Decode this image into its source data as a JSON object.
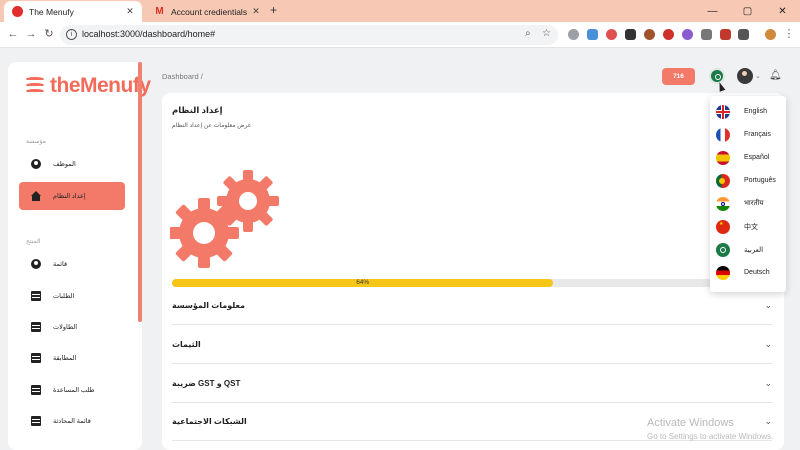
{
  "browser": {
    "tabs": [
      {
        "title": "The Menufy",
        "close": "✕"
      },
      {
        "title": "Account credientials - salimmal",
        "close": "✕"
      }
    ],
    "new_tab": "+",
    "url": "localhost:3000/dashboard/home#"
  },
  "app": {
    "logo_text": "theMenufy",
    "sidebar": {
      "section1": "مؤسسة",
      "items1": [
        {
          "label": "الموظف",
          "icon": "person-icon"
        },
        {
          "label": "إعداد النظام",
          "icon": "home-icon",
          "active": true
        }
      ],
      "section2": "المنتج",
      "items2": [
        {
          "label": "قائمة",
          "icon": "person-icon"
        },
        {
          "label": "الطلبات",
          "icon": "table-icon"
        },
        {
          "label": "الطاولات",
          "icon": "table-icon"
        },
        {
          "label": "المطابقة",
          "icon": "table-icon"
        },
        {
          "label": "طلب المساعدة",
          "icon": "table-icon"
        },
        {
          "label": "قائمة المحادثة",
          "icon": "table-icon"
        }
      ]
    },
    "breadcrumb": "Dashboard  /",
    "header": {
      "count_badge": "716"
    },
    "card": {
      "title": "إعداد النظام",
      "subtitle": "عرض معلومات عن إعداد النظام",
      "progress": {
        "percent": 64,
        "label": "64%"
      },
      "sections": [
        {
          "label": "معلومات المؤسسة"
        },
        {
          "label": "الثيمات"
        },
        {
          "label": "ضريبة GST و QST"
        },
        {
          "label": "الشبكات الاجتماعية"
        }
      ]
    },
    "language_menu": [
      {
        "name": "English",
        "flag": "uk"
      },
      {
        "name": "Français",
        "flag": "fr"
      },
      {
        "name": "Español",
        "flag": "es"
      },
      {
        "name": "Português",
        "flag": "pt"
      },
      {
        "name": "भारतीय",
        "flag": "in"
      },
      {
        "name": "中文",
        "flag": "cn"
      },
      {
        "name": "العربية",
        "flag": "sa"
      },
      {
        "name": "Deutsch",
        "flag": "de"
      }
    ]
  },
  "os": {
    "watermark_title": "Activate Windows",
    "watermark_sub": "Go to Settings to activate Windows."
  },
  "colors": {
    "accent": "#f37a69",
    "progress": "#f5c518"
  }
}
